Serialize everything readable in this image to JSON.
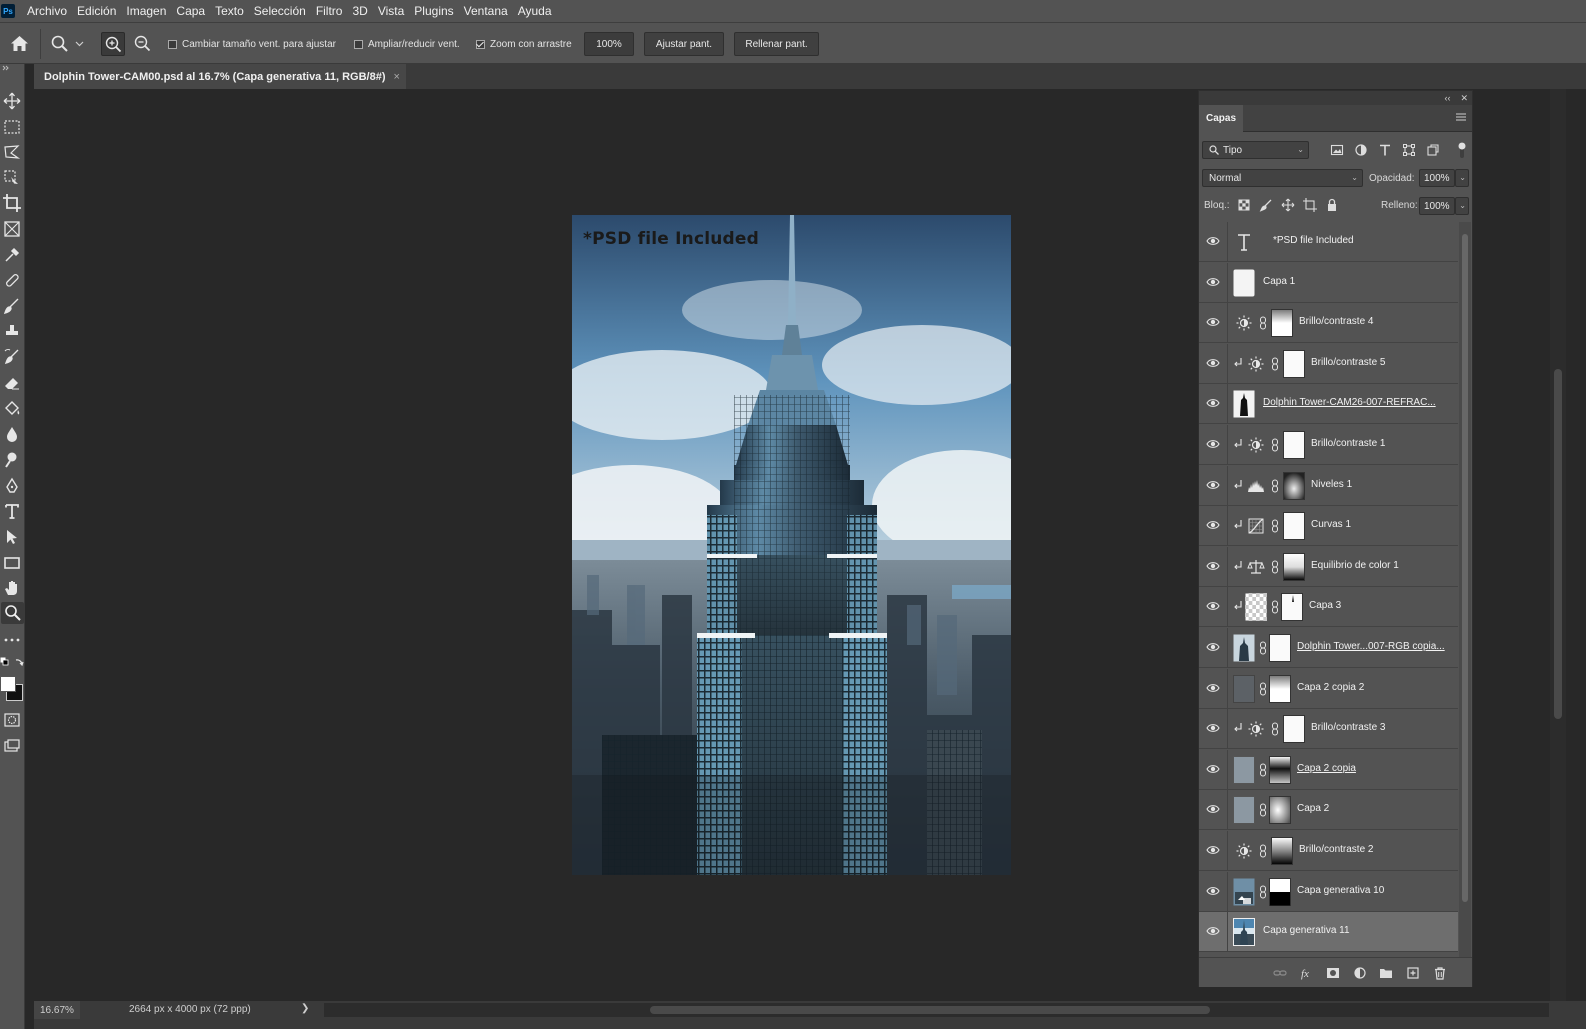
{
  "app": {
    "logo": "Ps"
  },
  "menu": [
    "Archivo",
    "Edición",
    "Imagen",
    "Capa",
    "Texto",
    "Selección",
    "Filtro",
    "3D",
    "Vista",
    "Plugins",
    "Ventana",
    "Ayuda"
  ],
  "options": {
    "resize_windows_label": "Cambiar tamaño vent. para ajustar",
    "resize_windows_checked": false,
    "zoom_all_label": "Ampliar/reducir vent.",
    "zoom_all_checked": false,
    "scrubby_zoom_label": "Zoom con arrastre",
    "scrubby_zoom_checked": true,
    "zoom_value": "100%",
    "fit_screen_label": "Ajustar pant.",
    "fill_screen_label": "Rellenar pant."
  },
  "document_tab": {
    "title": "Dolphin Tower-CAM00.psd al 16.7% (Capa generativa 11, RGB/8#)",
    "close": "×"
  },
  "artwork": {
    "overlay_text": "*PSD file Included"
  },
  "layers_panel": {
    "tab_label": "Capas",
    "filter_kind": "Tipo",
    "blend_mode": "Normal",
    "opacity_label": "Opacidad:",
    "opacity_value": "100%",
    "lock_label": "Bloq.:",
    "fill_label": "Relleno:",
    "fill_value": "100%",
    "layers": [
      {
        "name": "*PSD file Included",
        "kind": "text",
        "clipped": false,
        "mask": "none",
        "underline": false
      },
      {
        "name": "Capa 1",
        "kind": "pixel-white",
        "clipped": false,
        "mask": "none",
        "underline": false
      },
      {
        "name": "Brillo/contraste 4",
        "kind": "brightness",
        "clipped": false,
        "mask": "gradient-top",
        "underline": false
      },
      {
        "name": "Brillo/contraste 5",
        "kind": "brightness",
        "clipped": true,
        "mask": "white",
        "underline": false
      },
      {
        "name": "Dolphin Tower-CAM26-007-REFRAC...",
        "kind": "smart-tower",
        "clipped": false,
        "mask": "none",
        "underline": true
      },
      {
        "name": "Brillo/contraste 1",
        "kind": "brightness",
        "clipped": true,
        "mask": "white",
        "underline": false
      },
      {
        "name": "Niveles 1",
        "kind": "levels",
        "clipped": true,
        "mask": "radial",
        "underline": false
      },
      {
        "name": "Curvas 1",
        "kind": "curves",
        "clipped": true,
        "mask": "white",
        "underline": false
      },
      {
        "name": "Equilibrio de color 1",
        "kind": "color-balance",
        "clipped": true,
        "mask": "gradient-bottom-black",
        "underline": false
      },
      {
        "name": "Capa 3",
        "kind": "transparent",
        "clipped": true,
        "mask": "white-dark",
        "underline": false
      },
      {
        "name": "Dolphin Tower...007-RGB copia...",
        "kind": "tower-photo",
        "clipped": false,
        "mask": "white",
        "underline": true
      },
      {
        "name": "Capa 2 copia 2",
        "kind": "gray-dark",
        "clipped": false,
        "mask": "gradient-top",
        "underline": false
      },
      {
        "name": "Brillo/contraste 3",
        "kind": "brightness",
        "clipped": true,
        "mask": "white",
        "underline": false
      },
      {
        "name": "Capa 2 copia",
        "kind": "gray-light",
        "clipped": false,
        "mask": "gradient-mid",
        "underline": true
      },
      {
        "name": "Capa 2",
        "kind": "gray-light",
        "clipped": false,
        "mask": "radial-light",
        "underline": false
      },
      {
        "name": "Brillo/contraste 2",
        "kind": "brightness",
        "clipped": false,
        "mask": "dark-bottom",
        "underline": false
      },
      {
        "name": "Capa generativa 10",
        "kind": "generative-10",
        "clipped": false,
        "mask": "black-bottom",
        "underline": false
      },
      {
        "name": "Capa generativa 11",
        "kind": "generative-11",
        "clipped": false,
        "mask": "none",
        "underline": false,
        "selected": true
      }
    ]
  },
  "status": {
    "zoom": "16.67%",
    "doc_info": "2664 px x 4000 px (72 ppp)",
    "arrow": "❯"
  },
  "colors": {
    "ui_bg": "#535353",
    "canvas_bg": "#282828",
    "sky": "#4b7fa8",
    "selection": "#6e6e6e"
  }
}
